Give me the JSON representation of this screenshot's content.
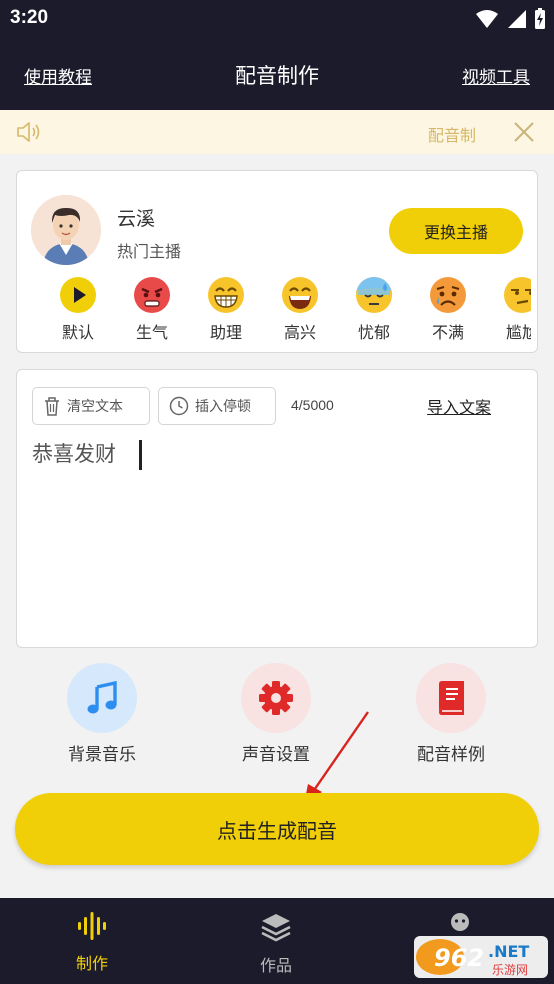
{
  "status_bar": {
    "time": "3:20"
  },
  "header": {
    "left_link": "使用教程",
    "title": "配音制作",
    "right_link": "视频工具"
  },
  "notice": {
    "text": "配音制"
  },
  "anchor": {
    "name": "云溪",
    "subtitle": "热门主播",
    "change_button": "更换主播"
  },
  "emotions": [
    {
      "label": "默认",
      "icon": "play-icon",
      "color": "#f1cf08"
    },
    {
      "label": "生气",
      "icon": "angry-face-icon",
      "color": "#e84a4a"
    },
    {
      "label": "助理",
      "icon": "grin-face-icon",
      "color": "#f7c52b"
    },
    {
      "label": "高兴",
      "icon": "happy-face-icon",
      "color": "#f7c52b"
    },
    {
      "label": "忧郁",
      "icon": "sad-sweat-face-icon",
      "color": "#7cc3f0"
    },
    {
      "label": "不满",
      "icon": "worried-face-icon",
      "color": "#f59a3a"
    },
    {
      "label": "尴尬",
      "icon": "awkward-face-icon",
      "color": "#f7c52b"
    }
  ],
  "editor": {
    "clear_button": "清空文本",
    "insert_pause_button": "插入停顿",
    "counter": "4/5000",
    "import_link": "导入文案",
    "text": "恭喜发财"
  },
  "features": [
    {
      "label": "背景音乐",
      "icon": "music-note-icon",
      "bg": "#d6e8fb",
      "fg": "#2d8ef0"
    },
    {
      "label": "声音设置",
      "icon": "gear-icon",
      "bg": "#f8e2e2",
      "fg": "#e02a2a"
    },
    {
      "label": "配音样例",
      "icon": "book-icon",
      "bg": "#f8e2e2",
      "fg": "#e02a2a"
    }
  ],
  "generate_button": "点击生成配音",
  "bottom_nav": [
    {
      "label": "制作",
      "icon": "sound-wave-icon",
      "active": true
    },
    {
      "label": "作品",
      "icon": "layers-icon",
      "active": false
    },
    {
      "label": "",
      "icon": "robot-icon",
      "active": false
    }
  ],
  "watermark": {
    "text": "962.NET",
    "sub": "乐游网"
  },
  "colors": {
    "accent": "#f1cf08",
    "header_bg": "#1c1b2b"
  }
}
